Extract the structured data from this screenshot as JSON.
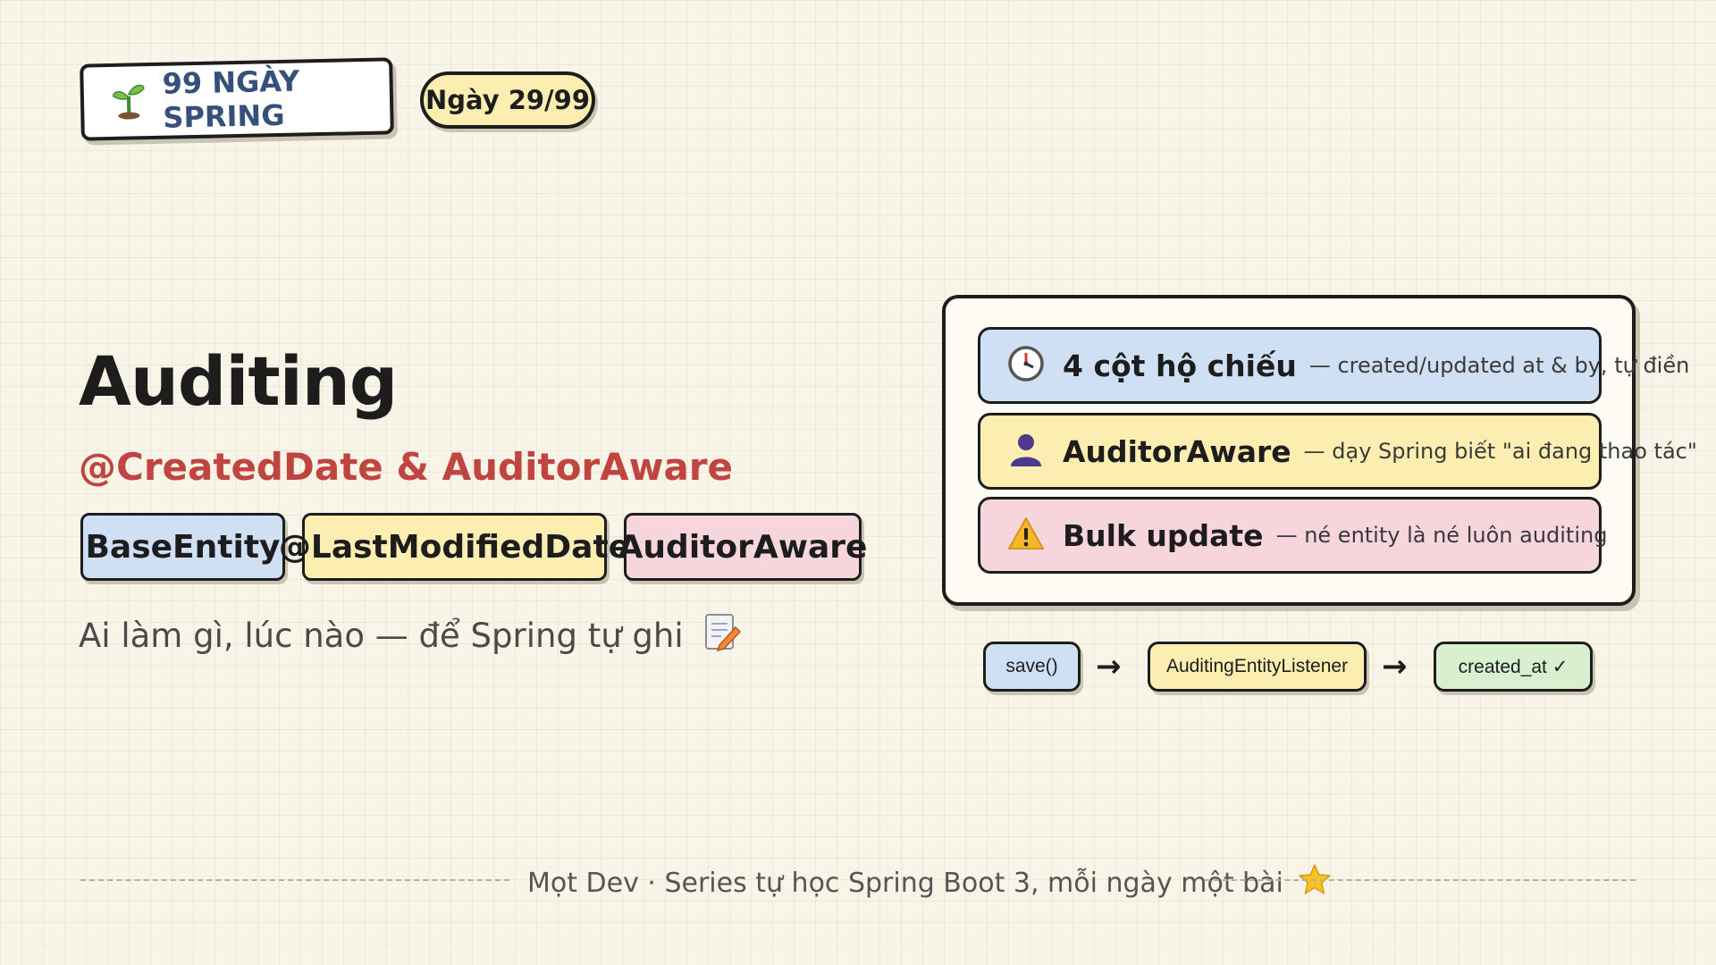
{
  "header": {
    "series_label": "99 NGÀY SPRING",
    "series_icon": "seedling-icon",
    "day_label": "Ngày 29/99"
  },
  "main": {
    "title": "Auditing",
    "subtitle": "@CreatedDate & AuditorAware",
    "chips": [
      "BaseEntity",
      "@LastModifiedDate",
      "AuditorAware"
    ],
    "tagline": "Ai làm gì, lúc nào — để Spring tự ghi",
    "tagline_icon": "memo-pencil-icon"
  },
  "panel": {
    "rows": [
      {
        "icon": "clock-icon",
        "title": "4 cột hộ chiếu",
        "desc": "— created/updated at & by, tự điền",
        "color": "#cfe0f5"
      },
      {
        "icon": "person-icon",
        "title": "AuditorAware",
        "desc": "— dạy Spring biết \"ai đang thao tác\"",
        "color": "#fbeeb0"
      },
      {
        "icon": "warning-icon",
        "title": "Bulk update",
        "desc": "— né entity là né luôn auditing",
        "color": "#f7d5dd"
      }
    ]
  },
  "flow": {
    "steps": [
      "save()",
      "AuditingEntityListener",
      "created_at ✓"
    ],
    "arrow": "→"
  },
  "footer": {
    "text": "Mọt Dev · Series tự học Spring Boot 3, mỗi ngày một bài",
    "icon": "star-icon"
  },
  "colors": {
    "background": "#f8f4e8",
    "accent_red": "#c0443f",
    "series_blue": "#35507c",
    "blue": "#cfe0f5",
    "yellow": "#fbeeb0",
    "pink": "#f7d5dd",
    "green": "#d8efd0"
  }
}
